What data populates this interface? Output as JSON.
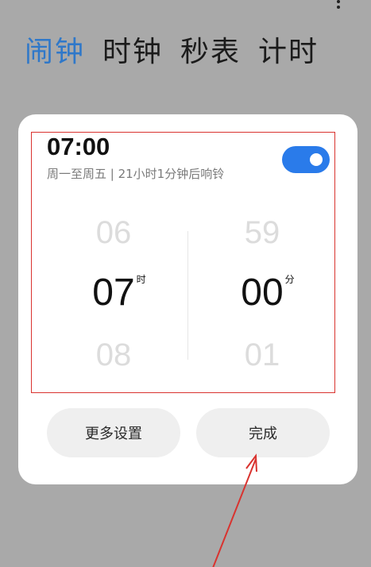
{
  "tabs": [
    {
      "label": "闹钟",
      "active": true
    },
    {
      "label": "时钟",
      "active": false
    },
    {
      "label": "秒表",
      "active": false
    },
    {
      "label": "计时",
      "active": false
    }
  ],
  "alarm": {
    "time": "07:00",
    "subtitle": "周一至周五 | 21小时1分钟后响铃",
    "enabled": true
  },
  "picker": {
    "hours": {
      "prev": "06",
      "current": "07",
      "next": "08",
      "unit": "时"
    },
    "minutes": {
      "prev": "59",
      "current": "00",
      "next": "01",
      "unit": "分"
    }
  },
  "buttons": {
    "more_settings": "更多设置",
    "done": "完成"
  },
  "colors": {
    "accent": "#2f78c9",
    "toggle_on": "#2a7bea",
    "annotation": "#d9332f",
    "backdrop": "#a9a9a9"
  },
  "icons": {
    "menu": "more-vertical-icon"
  }
}
